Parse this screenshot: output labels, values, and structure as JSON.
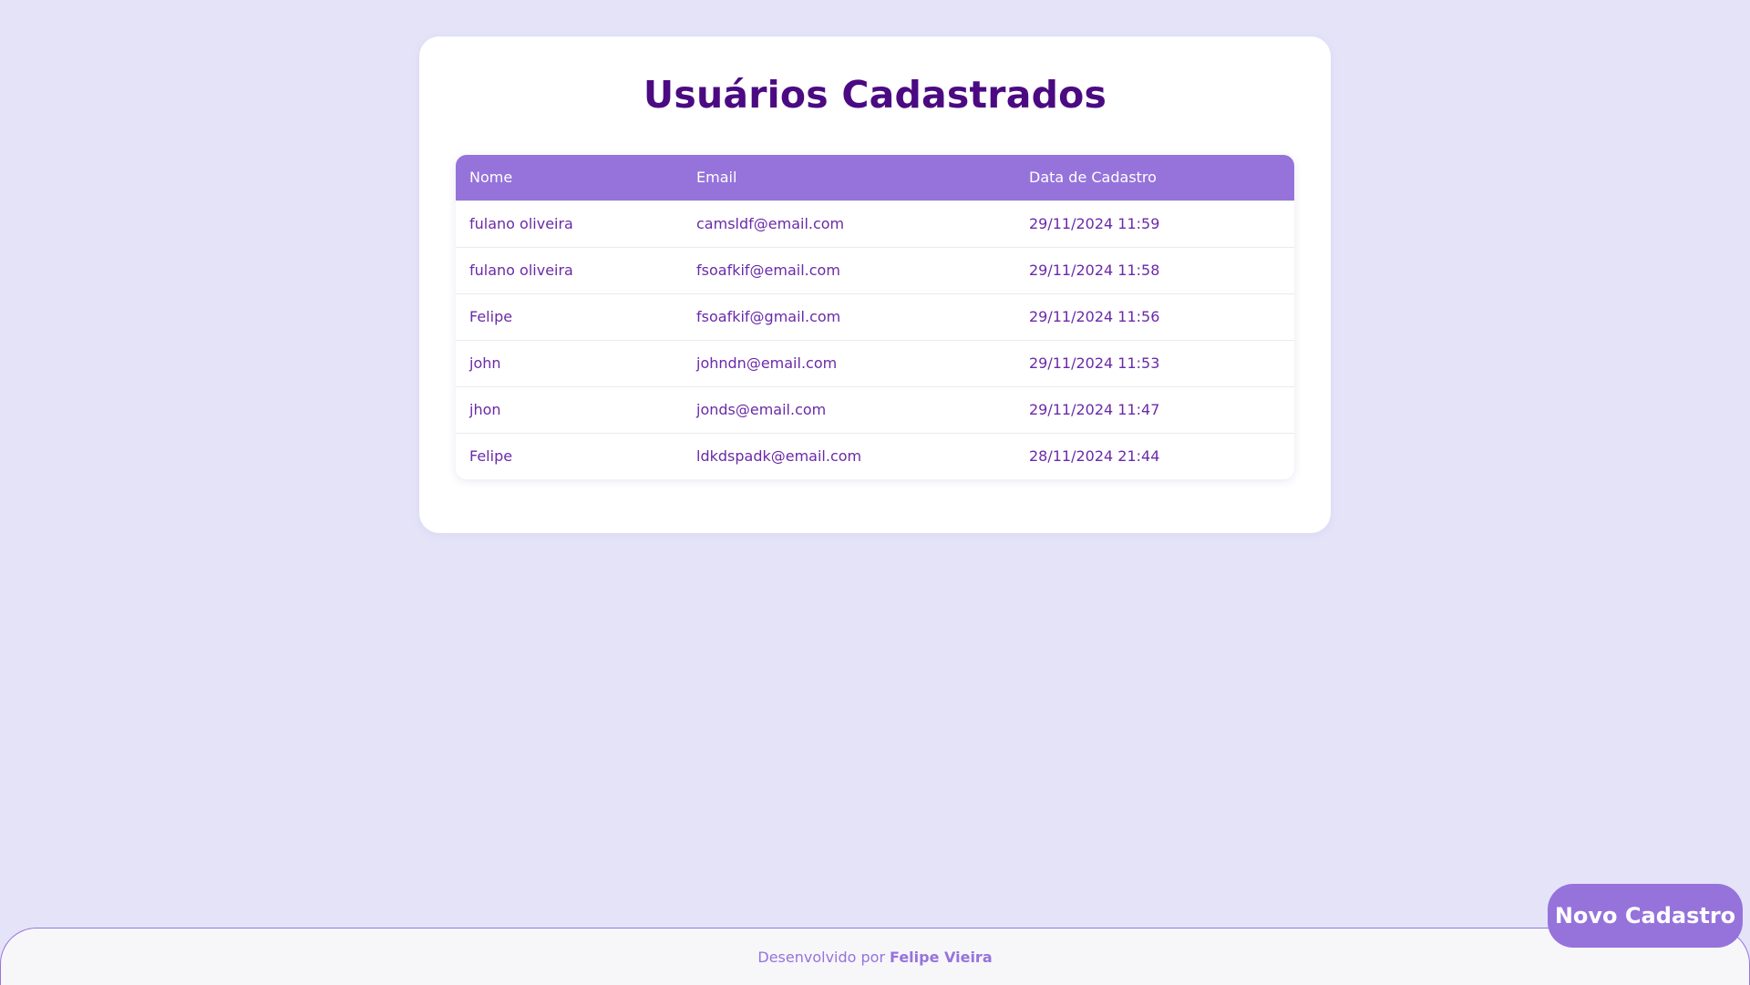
{
  "page": {
    "title": "Usuários Cadastrados"
  },
  "table": {
    "headers": [
      "Nome",
      "Email",
      "Data de Cadastro"
    ],
    "rows": [
      {
        "nome": "fulano oliveira",
        "email": "camsldf@email.com",
        "data": "29/11/2024 11:59"
      },
      {
        "nome": "fulano oliveira",
        "email": "fsoafkif@email.com",
        "data": "29/11/2024 11:58"
      },
      {
        "nome": "Felipe",
        "email": "fsoafkif@gmail.com",
        "data": "29/11/2024 11:56"
      },
      {
        "nome": "john",
        "email": "johndn@email.com",
        "data": "29/11/2024 11:53"
      },
      {
        "nome": "jhon",
        "email": "jonds@email.com",
        "data": "29/11/2024 11:47"
      },
      {
        "nome": "Felipe",
        "email": "ldkdspadk@email.com",
        "data": "28/11/2024 21:44"
      }
    ]
  },
  "actions": {
    "new_label": "Novo Cadastro"
  },
  "footer": {
    "prefix": "Desenvolvido por",
    "author": "Felipe Vieira"
  },
  "colors": {
    "background": "#e4e3f8",
    "accent": "#9673db",
    "title": "#4b0a82",
    "text": "#6a2aa8"
  }
}
